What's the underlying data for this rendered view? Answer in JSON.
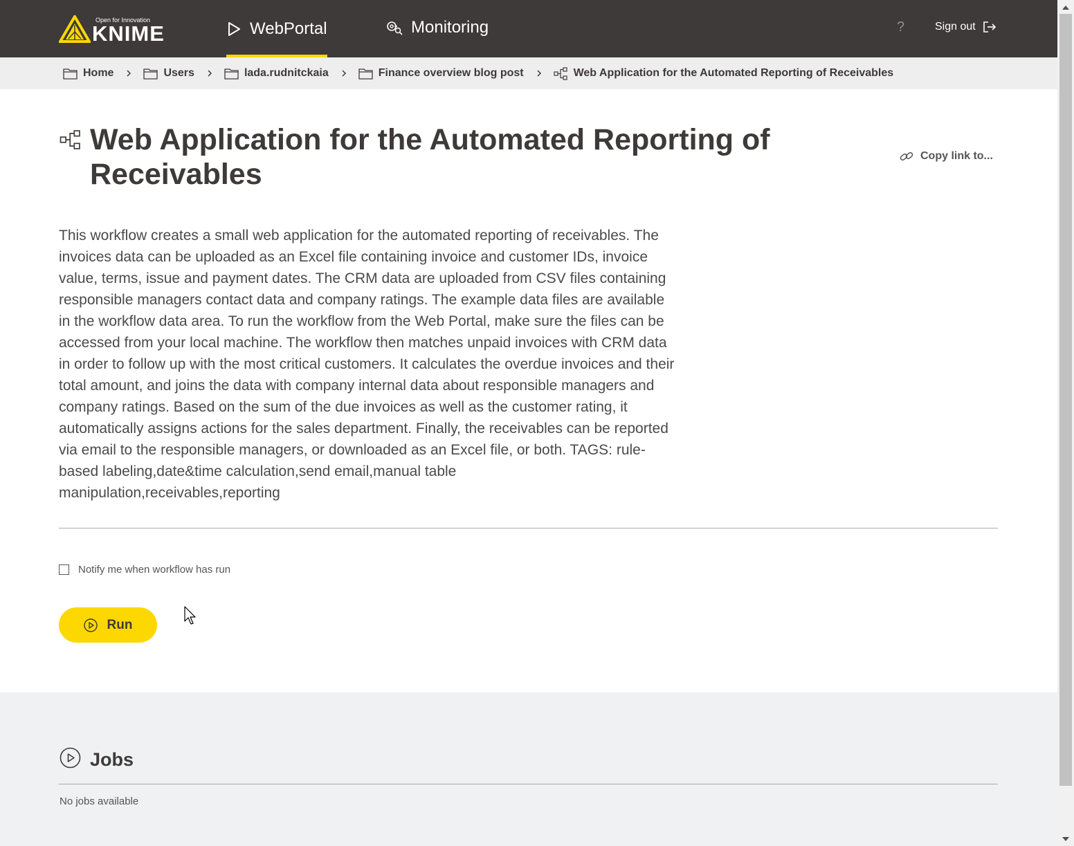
{
  "header": {
    "logo_tagline": "Open for Innovation",
    "logo_text": "KNIME",
    "nav": [
      {
        "label": "WebPortal",
        "icon": "play-icon",
        "active": true
      },
      {
        "label": "Monitoring",
        "icon": "monitoring-icon",
        "active": false
      }
    ],
    "help_label": "?",
    "signout_label": "Sign out"
  },
  "breadcrumb": [
    {
      "label": "Home",
      "icon": "folder-icon"
    },
    {
      "label": "Users",
      "icon": "folder-icon"
    },
    {
      "label": "lada.rudnitckaia",
      "icon": "folder-icon"
    },
    {
      "label": "Finance overview blog post",
      "icon": "folder-icon"
    },
    {
      "label": "Web Application for the Automated Reporting of Receivables",
      "icon": "workflow-icon"
    }
  ],
  "workflow": {
    "title": "Web Application for the Automated Reporting of Receivables",
    "copy_link_label": "Copy link to...",
    "description": "This workflow creates a small web application for the automated reporting of receivables. The invoices data can be uploaded as an Excel file containing invoice and customer IDs, invoice value, terms, issue and payment dates. The CRM data are uploaded from CSV files containing responsible managers contact data and company ratings. The example data files are available in the workflow data area. To run the workflow from the Web Portal, make sure the files can be accessed from your local machine. The workflow then matches unpaid invoices with CRM data in order to follow up with the most critical customers. It calculates the overdue invoices and their total amount, and joins the data with company internal data about responsible managers and company ratings. Based on the sum of the due invoices as well as the customer rating, it automatically assigns actions for the sales department. Finally, the receivables can be reported via email to the responsible managers, or downloaded as an Excel file, or both. TAGS: rule-based labeling,date&time calculation,send email,manual table manipulation,receivables,reporting",
    "notify_label": "Notify me when workflow has run",
    "notify_checked": false,
    "run_label": "Run"
  },
  "jobs": {
    "title": "Jobs",
    "empty_text": "No jobs available"
  },
  "colors": {
    "header_bg": "#3e3a39",
    "accent": "#fdd800",
    "breadcrumb_bg": "#eeeeef",
    "jobs_bg": "#f0f1f2"
  }
}
